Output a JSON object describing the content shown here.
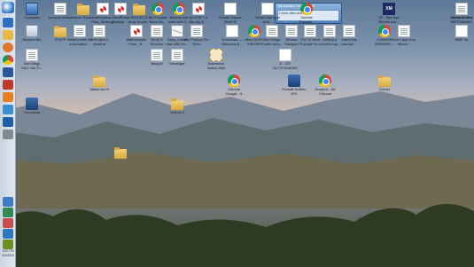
{
  "taskbar": {
    "clock_time": "9:00 PM",
    "clock_date": "2/4/2018",
    "icons": [
      "ie-icon",
      "folder-icon",
      "firefox-icon",
      "chrome-icon",
      "word-icon",
      "outlook-icon",
      "media-icon",
      "photos-icon",
      "calculator-icon",
      "notepad-icon",
      "network-icon",
      "volume-icon",
      "app-icon",
      "app-icon",
      "app-icon",
      "app-icon",
      "app-icon"
    ]
  },
  "widget": {
    "title": "Trip Advisor Travel Deals",
    "body": "Check rates and deals"
  },
  "desktop_icons": {
    "row1": [
      {
        "label": "Computer",
        "icon": "computer"
      },
      {
        "label": "Amazon Kindle",
        "icon": "doc"
      },
      {
        "label": "Home Theater",
        "icon": "folder"
      },
      {
        "label": "eBusiness Plan_Strategy",
        "icon": "pdf"
      },
      {
        "label": "WordPress Backup ...",
        "icon": "pdf"
      },
      {
        "label": "2018 08 20 Andy Morris...",
        "icon": "folder"
      },
      {
        "label": "Bio Fontaid Work Ho...",
        "icon": "chrome"
      },
      {
        "label": "Mounts that work with G...",
        "icon": "chrome"
      },
      {
        "label": "AVCHD 7.0 Blu-ray & ...",
        "icon": "pdf"
      },
      {
        "label": "Kodak Classic Stuff HF",
        "icon": "blank"
      },
      {
        "label": "What's the best virtu...",
        "icon": "blank"
      },
      {
        "label": "Sunrise Thought...",
        "icon": "chrome"
      },
      {
        "label": "XE - Bye Bye Blockbuste...",
        "icon": "xm"
      },
      {
        "label": "Amazon.com MRT338MAC",
        "icon": "amazon"
      },
      {
        "label": "Author Outline",
        "icon": "doc"
      }
    ],
    "row2": [
      {
        "label": "Recycle Bin",
        "icon": "bin"
      },
      {
        "label": "STUFF",
        "icon": "folder"
      },
      {
        "label": "Bullet points for Informative...",
        "icon": "doc"
      },
      {
        "label": "Web Idea 2 desktop",
        "icon": "doc"
      },
      {
        "label": "Watermarker Tools - B...",
        "icon": "pdf"
      },
      {
        "label": "Droid X Shortcut",
        "icon": "doc"
      },
      {
        "label": "Easy_Install Mac with Ho...",
        "icon": "mail"
      },
      {
        "label": "My Product Pix - Tech...",
        "icon": "doc"
      },
      {
        "label": "Download — Windows 8...",
        "icon": "blank"
      },
      {
        "label": "Ultra MUSIC THEORY",
        "icon": "chrome"
      },
      {
        "label": "San Diego Public Libra...",
        "icon": "doc"
      },
      {
        "label": "Review Passport",
        "icon": "doc"
      },
      {
        "label": "The 10 Most Popular Fo...",
        "icon": "doc"
      },
      {
        "label": "Getting a HomeGroup...",
        "icon": "doc"
      },
      {
        "label": "Insert this channel ...",
        "icon": "doc"
      },
      {
        "label": "CONNOR ORNF805 ...",
        "icon": "chrome"
      },
      {
        "label": "Can I sign in to Windo...",
        "icon": "doc"
      },
      {
        "label": "WMF Air",
        "icon": "blank"
      }
    ],
    "row3": [
      {
        "label": "San Diego HAC Info Tr...",
        "icon": "doc"
      },
      {
        "label": "Blog kit",
        "icon": "doc"
      },
      {
        "label": "Moonlight",
        "icon": "doc"
      },
      {
        "label": "Downtown Abbey Wiki",
        "icon": "stamp"
      },
      {
        "label": "5 - 1ST OUTSTANDING...",
        "icon": "blank"
      }
    ],
    "row4": [
      {
        "label": "Tables for Hi",
        "icon": "folder"
      },
      {
        "label": "Chrome Google - 8",
        "icon": "chrome"
      },
      {
        "label": "Portrait NoSkin 8TK",
        "icon": "app"
      },
      {
        "label": "Dropbox - 68 Chrome",
        "icon": "chrome"
      },
      {
        "label": "Corner",
        "icon": "folder"
      }
    ],
    "row5": [
      {
        "label": "Thumbnail",
        "icon": "app"
      },
      {
        "label": "Outbox 2",
        "icon": "folder"
      }
    ],
    "row6": [
      {
        "label": "",
        "icon": "folder"
      }
    ]
  }
}
